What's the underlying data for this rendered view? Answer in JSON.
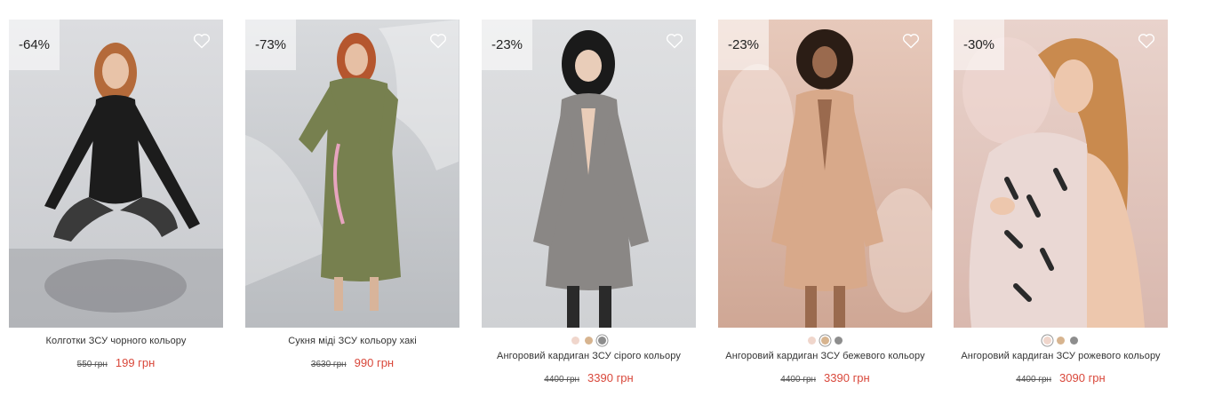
{
  "products": [
    {
      "discount": "-64%",
      "title": "Колготки ЗСУ чорного кольору",
      "old_price": "550 грн",
      "new_price": "199 грн",
      "swatches": [],
      "colors": {
        "bg_top": "#dcdde0",
        "bg_bottom": "#c7c9cd",
        "garment": "#1c1c1c",
        "hair": "#b46a3a",
        "skin": "#e8c3a8"
      }
    },
    {
      "discount": "-73%",
      "title": "Сукня міді ЗСУ кольору хакі",
      "old_price": "3630 грн",
      "new_price": "990 грн",
      "swatches": [],
      "colors": {
        "bg_top": "#d8dadd",
        "bg_bottom": "#b9bcc0",
        "garment": "#77804f",
        "hair": "#b5562e",
        "skin": "#e6bfa4"
      }
    },
    {
      "discount": "-23%",
      "title": "Ангоровий кардиган ЗСУ сірого кольору",
      "old_price": "4400 грн",
      "new_price": "3390 грн",
      "swatches": [
        {
          "color": "#f0d6cc",
          "selected": false
        },
        {
          "color": "#d7b48f",
          "selected": false
        },
        {
          "color": "#8d8d8d",
          "selected": true
        }
      ],
      "colors": {
        "bg_top": "#dfe0e2",
        "bg_bottom": "#cfd1d4",
        "garment": "#8a8785",
        "hair": "#1a1a1a",
        "skin": "#e9cdb9"
      }
    },
    {
      "discount": "-23%",
      "title": "Ангоровий кардиган ЗСУ бежевого кольору",
      "old_price": "4400 грн",
      "new_price": "3390 грн",
      "swatches": [
        {
          "color": "#f0d6cc",
          "selected": false
        },
        {
          "color": "#d7b48f",
          "selected": true
        },
        {
          "color": "#8d8d8d",
          "selected": false
        }
      ],
      "colors": {
        "bg_top": "#e7c9bb",
        "bg_bottom": "#cfa795",
        "garment": "#d8a98a",
        "hair": "#2b1d15",
        "skin": "#9a6a4e"
      }
    },
    {
      "discount": "-30%",
      "title": "Ангоровий кардиган ЗСУ рожевого кольору",
      "old_price": "4400 грн",
      "new_price": "3090 грн",
      "swatches": [
        {
          "color": "#f0d6cc",
          "selected": true
        },
        {
          "color": "#d7b48f",
          "selected": false
        },
        {
          "color": "#8d8d8d",
          "selected": false
        }
      ],
      "colors": {
        "bg_top": "#e9d3cc",
        "bg_bottom": "#d9b8ae",
        "garment": "#ead8d4",
        "hair": "#c98a4e",
        "skin": "#edc7ad"
      }
    }
  ]
}
